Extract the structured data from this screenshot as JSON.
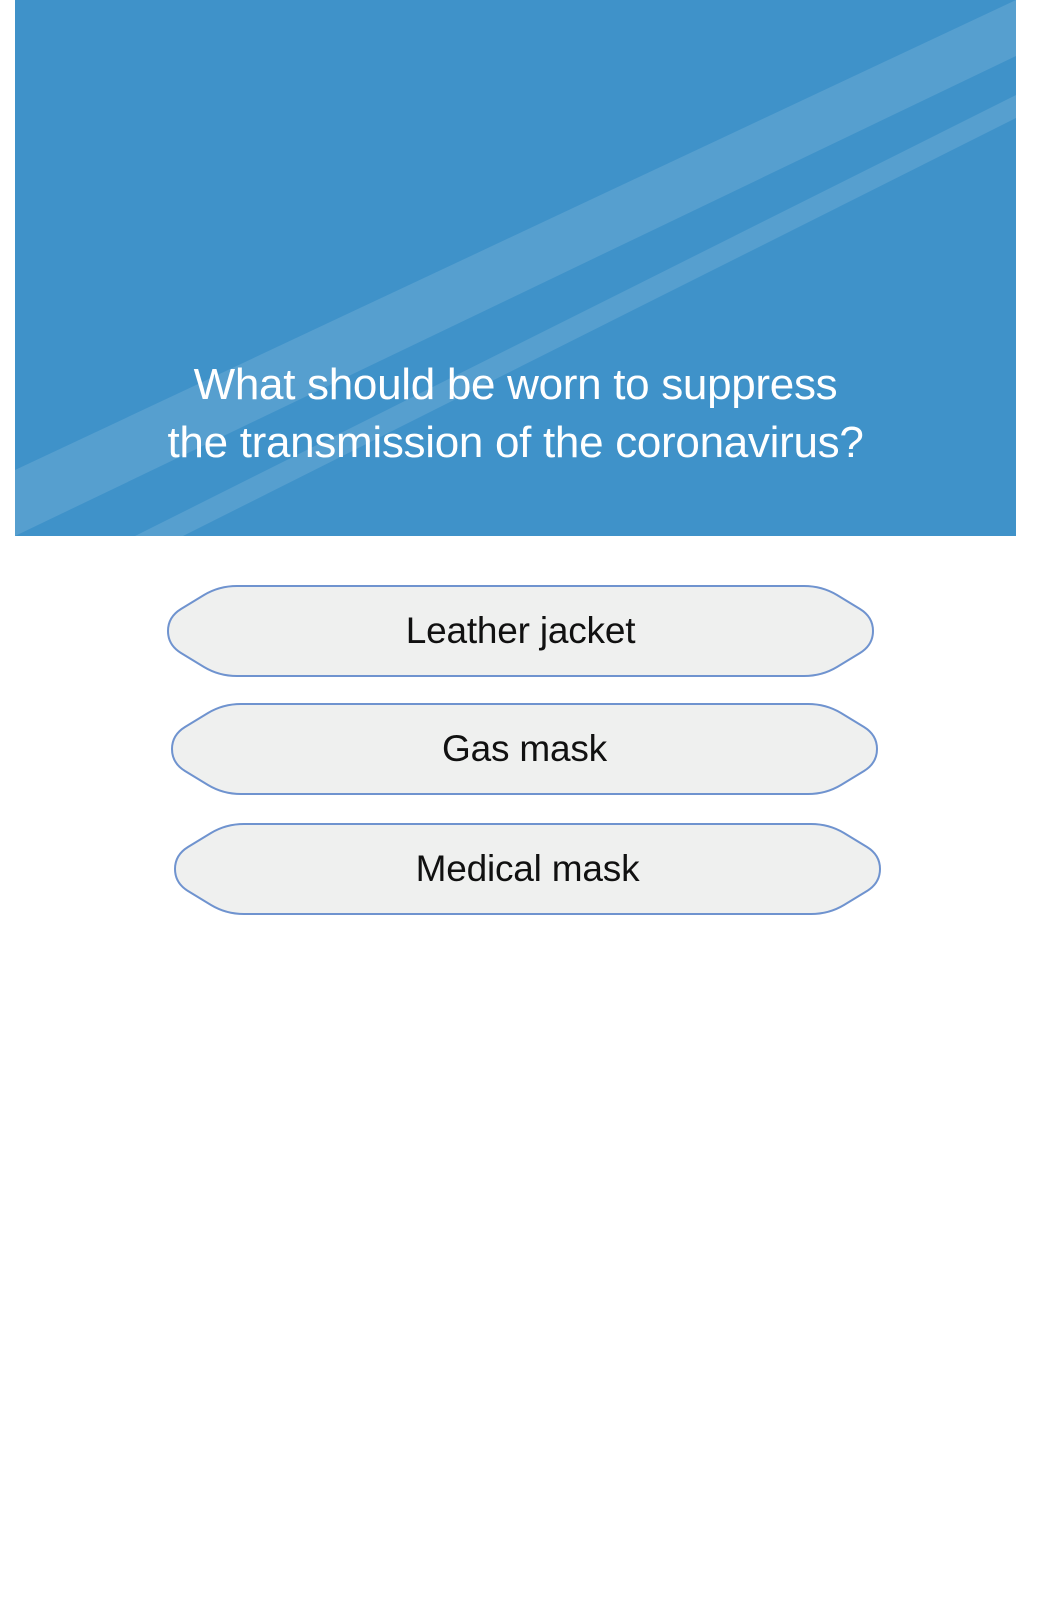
{
  "colors": {
    "panel_background": "#3f92c9",
    "option_fill": "#eff0ef",
    "option_border": "#6f93cf",
    "option_text": "#111111"
  },
  "question": {
    "line1": "What should be worn to suppress",
    "line2": "the transmission of the coronavirus?"
  },
  "answers": [
    {
      "label": "Leather jacket"
    },
    {
      "label": "Gas mask"
    },
    {
      "label": "Medical mask"
    }
  ]
}
